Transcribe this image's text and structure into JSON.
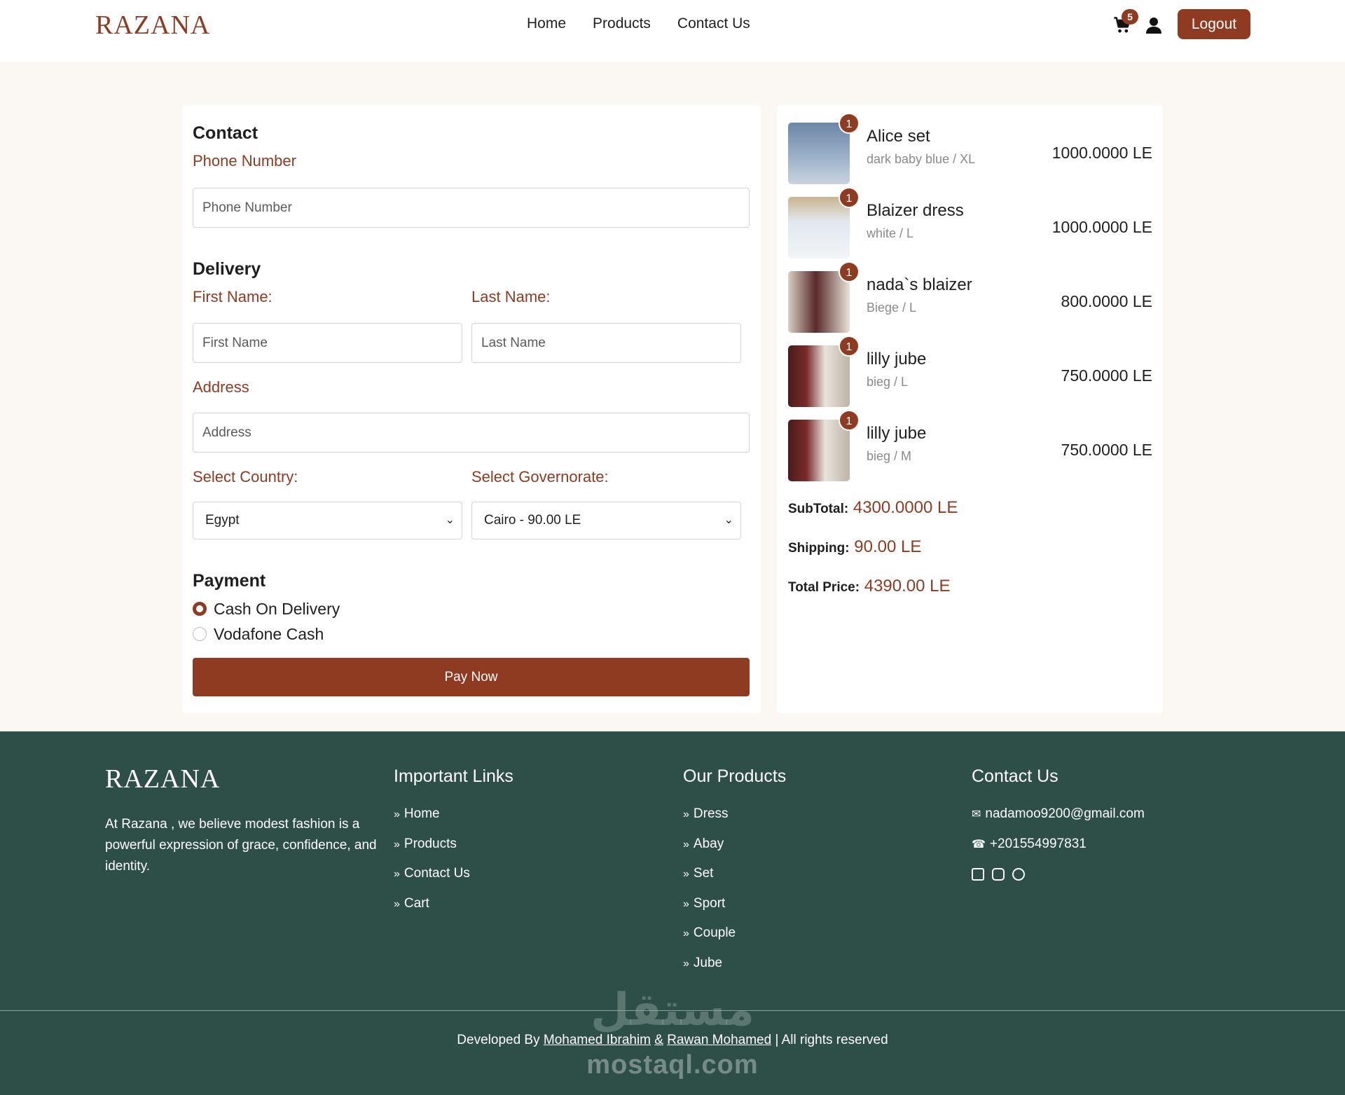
{
  "header": {
    "logo": "RAZANA",
    "nav": [
      "Home",
      "Products",
      "Contact Us"
    ],
    "cart_count": "5",
    "logout": "Logout"
  },
  "form": {
    "contact_heading": "Contact",
    "phone_label": "Phone Number",
    "phone_placeholder": "Phone Number",
    "delivery_heading": "Delivery",
    "first_name_label": "First Name:",
    "first_name_placeholder": "First Name",
    "last_name_label": "Last Name:",
    "last_name_placeholder": "Last Name",
    "address_label": "Address",
    "address_placeholder": "Address",
    "country_label": "Select Country:",
    "country_value": "Egypt",
    "governorate_label": "Select Governorate:",
    "governorate_value": "Cairo - 90.00 LE",
    "payment_heading": "Payment",
    "payment_options": [
      "Cash On Delivery",
      "Vodafone Cash"
    ],
    "payment_selected": "Cash On Delivery",
    "pay_button": "Pay Now"
  },
  "order": {
    "items": [
      {
        "qty": "1",
        "name": "Alice set",
        "variant": "dark baby blue / XL",
        "price": "1000.0000 LE"
      },
      {
        "qty": "1",
        "name": "Blaizer dress",
        "variant": "white / L",
        "price": "1000.0000 LE"
      },
      {
        "qty": "1",
        "name": "nada`s blaizer",
        "variant": "Biege / L",
        "price": "800.0000 LE"
      },
      {
        "qty": "1",
        "name": "lilly jube",
        "variant": "bieg / L",
        "price": "750.0000 LE"
      },
      {
        "qty": "1",
        "name": "lilly jube",
        "variant": "bieg / M",
        "price": "750.0000 LE"
      }
    ],
    "subtotal_label": "SubTotal:",
    "subtotal_value": "4300.0000 LE",
    "shipping_label": "Shipping:",
    "shipping_value": "90.00 LE",
    "total_label": "Total Price:",
    "total_value": "4390.00 LE"
  },
  "footer": {
    "logo": "RAZANA",
    "about": "At Razana , we believe modest fashion is a powerful expression of grace, confidence, and identity.",
    "links_heading": "Important Links",
    "links": [
      "Home",
      "Products",
      "Contact Us",
      "Cart"
    ],
    "products_heading": "Our Products",
    "products": [
      "Dress",
      "Abay",
      "Set",
      "Sport",
      "Couple",
      "Jube"
    ],
    "contact_heading": "Contact Us",
    "email": "nadamoo9200@gmail.com",
    "phone": "+201554997831",
    "credit_prefix": "Developed By",
    "credit_dev1": "Mohamed Ibrahim",
    "credit_amp": "&",
    "credit_dev2": "Rawan Mohamed",
    "credit_suffix": "| All rights reserved",
    "watermark": "mostaql.com",
    "watermark_ar": "مستقل"
  },
  "colors": {
    "brand": "#8f3b22",
    "footer_bg": "#2e4f47",
    "page_bg": "#fbf7f2"
  }
}
